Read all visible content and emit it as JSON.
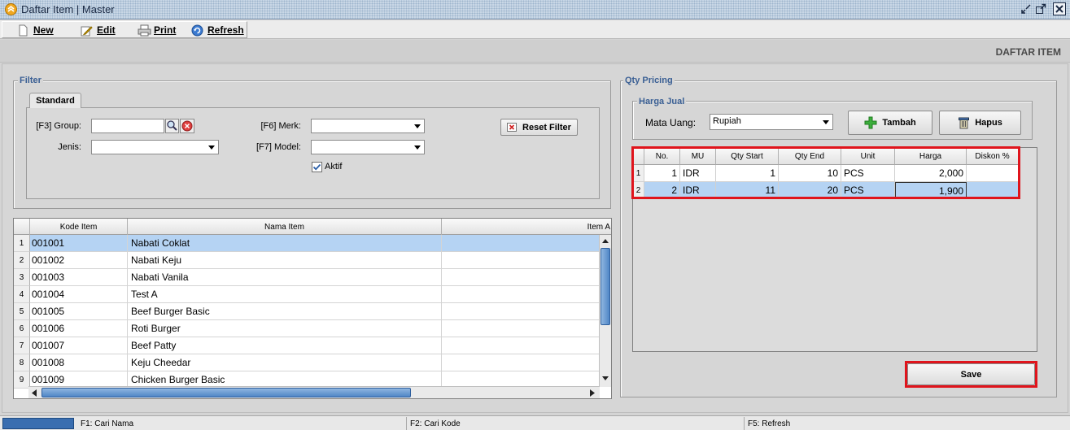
{
  "window": {
    "title": "Daftar Item | Master"
  },
  "toolbar": {
    "new_label": "New",
    "edit_label": "Edit",
    "print_label": "Print",
    "refresh_label": "Refresh"
  },
  "page": {
    "title": "DAFTAR ITEM"
  },
  "filter": {
    "title": "Filter",
    "tab_label": "Standard",
    "group_label": "[F3] Group:",
    "group_value": "",
    "jenis_label": "Jenis:",
    "jenis_value": "",
    "merk_label": "[F6] Merk:",
    "merk_value": "",
    "model_label": "[F7] Model:",
    "model_value": "",
    "aktif_label": "Aktif",
    "aktif_checked": true,
    "reset_label": "Reset Filter"
  },
  "items_grid": {
    "headers": [
      "Kode Item",
      "Nama Item",
      "Item A"
    ],
    "rows": [
      {
        "no": "1",
        "kode": "001001",
        "nama": "Nabati Coklat"
      },
      {
        "no": "2",
        "kode": "001002",
        "nama": "Nabati Keju"
      },
      {
        "no": "3",
        "kode": "001003",
        "nama": "Nabati Vanila"
      },
      {
        "no": "4",
        "kode": "001004",
        "nama": "Test A"
      },
      {
        "no": "5",
        "kode": "001005",
        "nama": "Beef Burger Basic"
      },
      {
        "no": "6",
        "kode": "001006",
        "nama": "Roti Burger"
      },
      {
        "no": "7",
        "kode": "001007",
        "nama": "Beef Patty"
      },
      {
        "no": "8",
        "kode": "001008",
        "nama": "Keju Cheedar"
      },
      {
        "no": "9",
        "kode": "001009",
        "nama": "Chicken Burger Basic"
      }
    ],
    "selected_row": 1
  },
  "qty_pricing": {
    "title": "Qty Pricing",
    "harga_jual_title": "Harga Jual",
    "mata_uang_label": "Mata Uang:",
    "mata_uang_value": "Rupiah",
    "tambah_label": "Tambah",
    "hapus_label": "Hapus",
    "headers": [
      "No.",
      "MU",
      "Qty Start",
      "Qty End",
      "Unit",
      "Harga",
      "Diskon %"
    ],
    "rows": [
      {
        "rn": "1",
        "no": "1",
        "mu": "IDR",
        "qty_start": "1",
        "qty_end": "10",
        "unit": "PCS",
        "harga": "2,000",
        "diskon": ""
      },
      {
        "rn": "2",
        "no": "2",
        "mu": "IDR",
        "qty_start": "11",
        "qty_end": "20",
        "unit": "PCS",
        "harga": "1,900",
        "diskon": ""
      }
    ],
    "save_label": "Save"
  },
  "statusbar": {
    "f1": "F1: Cari Nama",
    "f2": "F2: Cari Kode",
    "f5": "F5: Refresh"
  },
  "colors": {
    "highlight": "#e0141c",
    "selection": "#b5d3f3",
    "group_title": "#3a5f94"
  }
}
